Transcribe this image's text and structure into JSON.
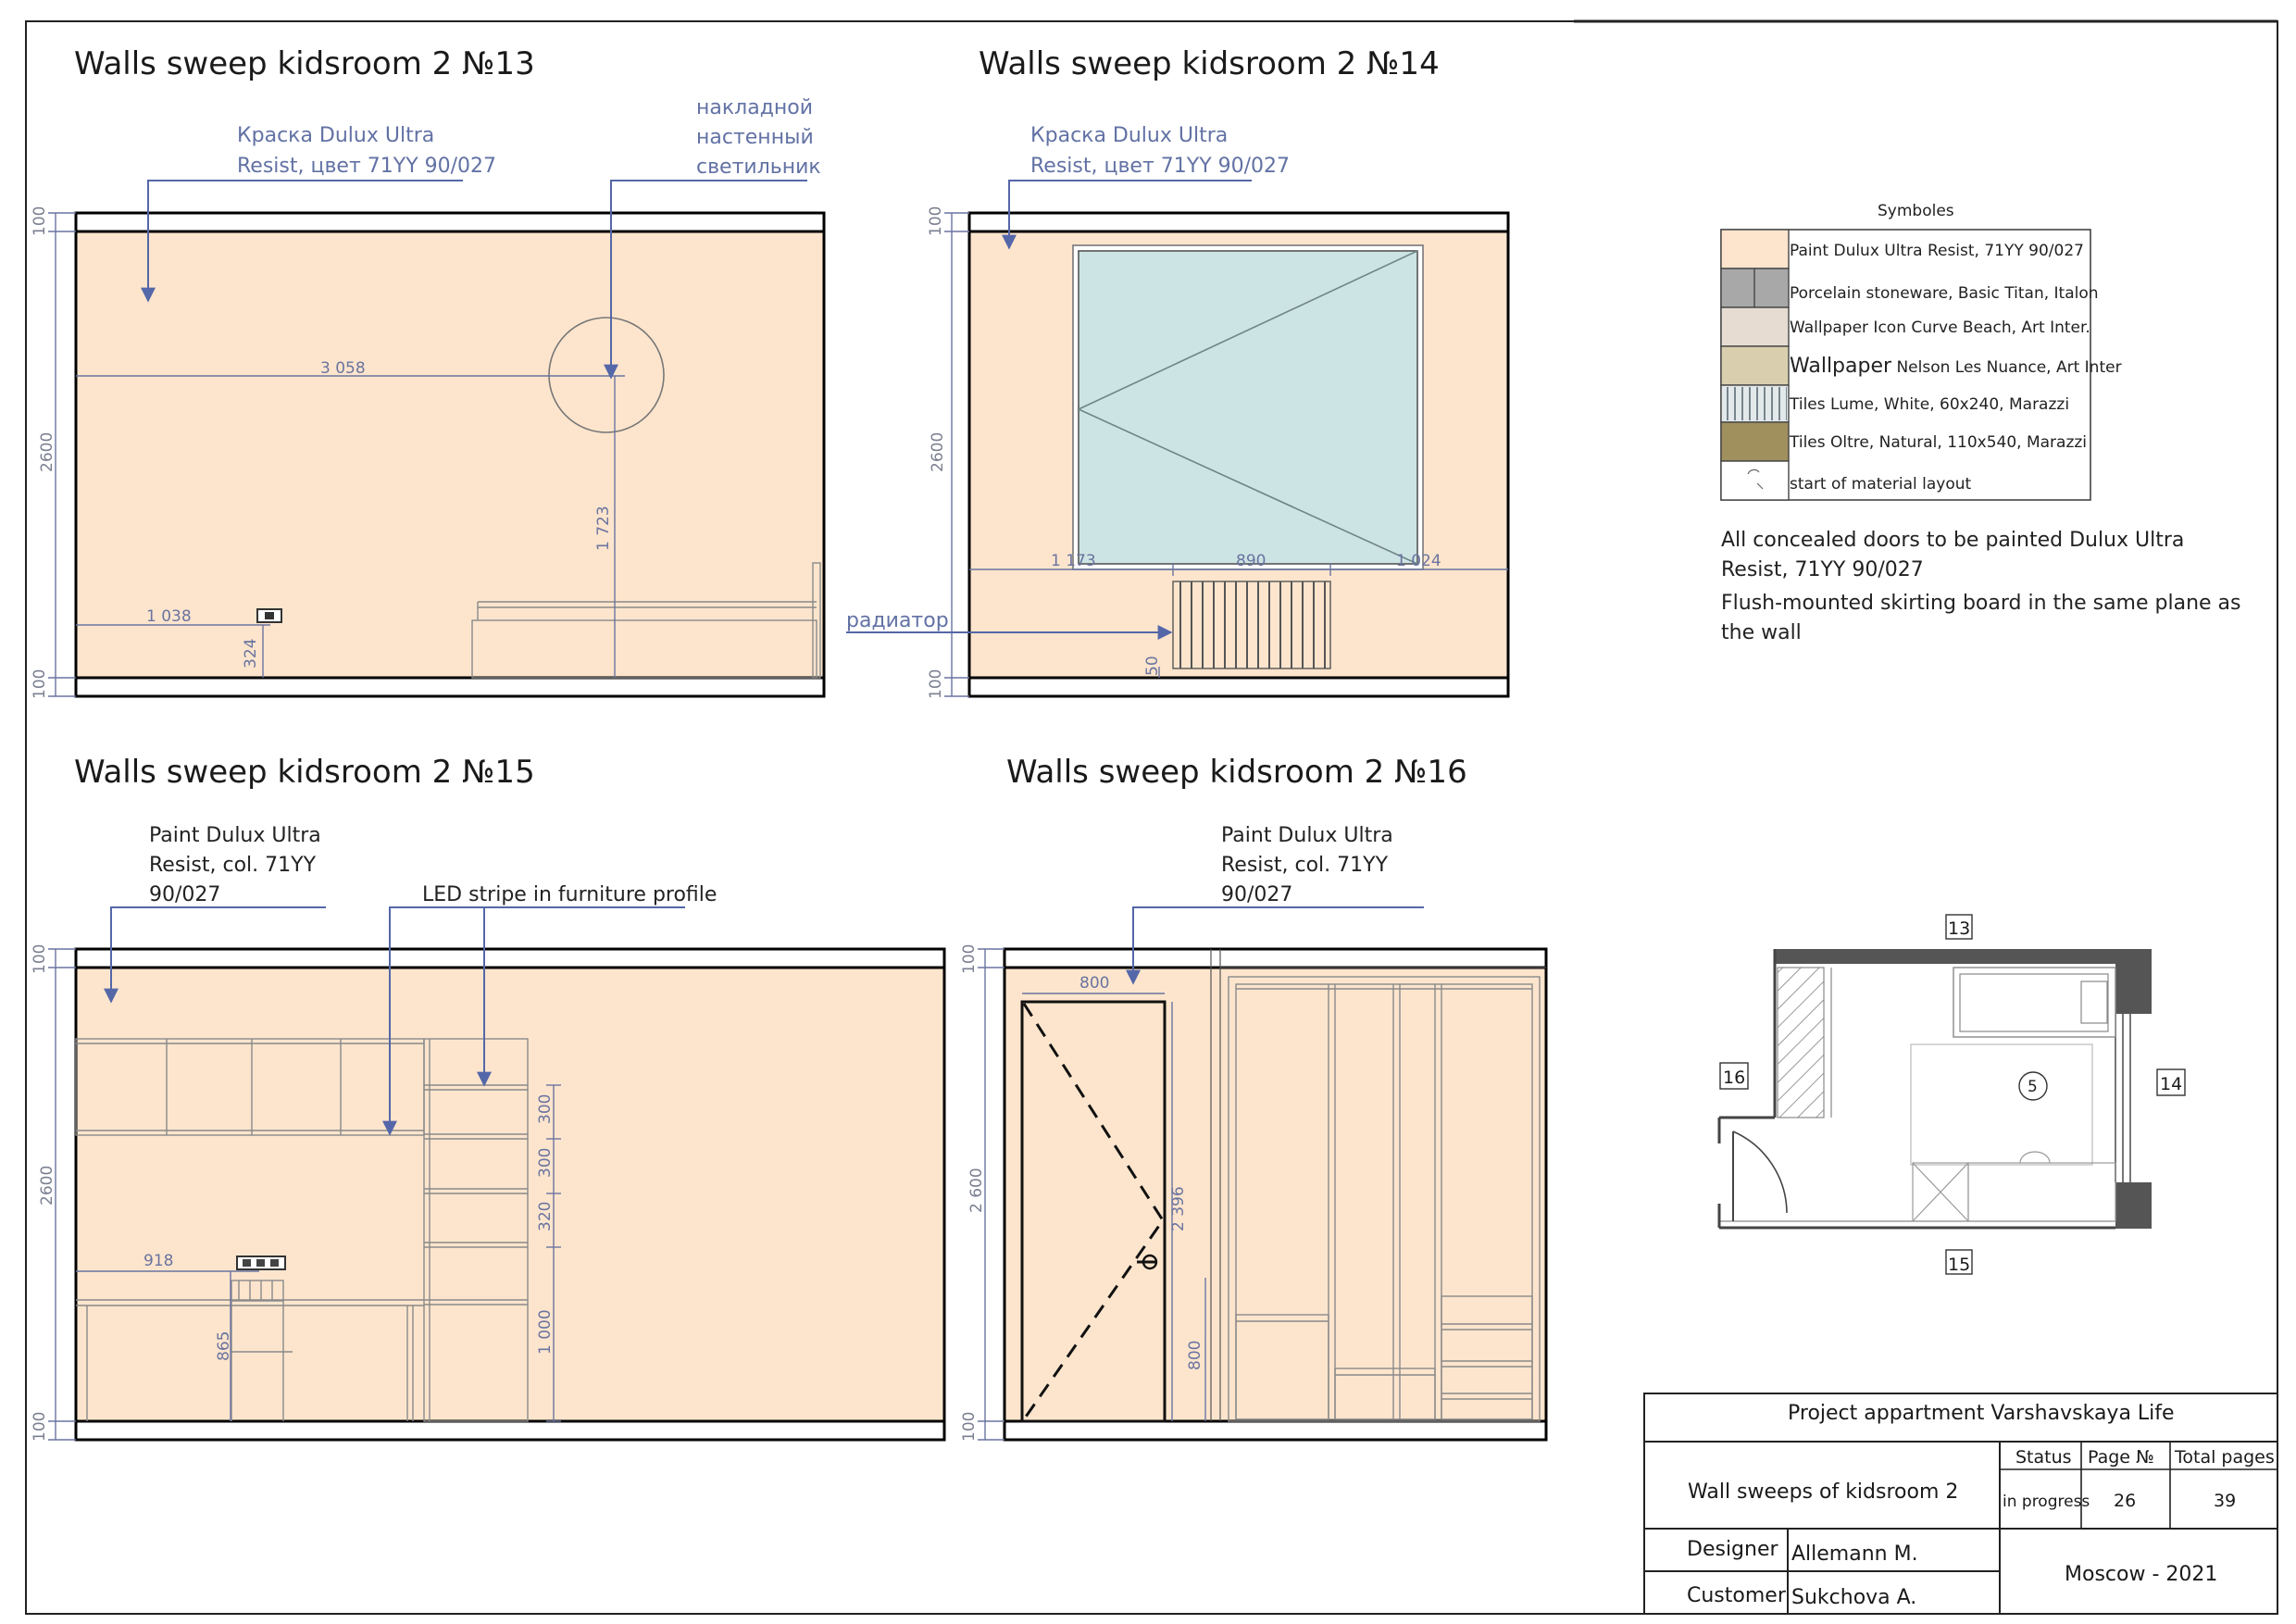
{
  "sheet": {
    "elevation_13": {
      "title": "Walls sweep kidsroom 2 №13",
      "note_paint": [
        "Краска Dulux Ultra",
        "Resist, цвет 71YY 90/027"
      ],
      "note_lamp": [
        "накладной",
        "настенный",
        "светильник"
      ],
      "dims": {
        "top": "100",
        "height": "2600",
        "bottom": "100",
        "width": "3 058",
        "lamp_height": "1 723",
        "socket_offset": "1 038",
        "socket_height": "324"
      }
    },
    "elevation_14": {
      "title": "Walls sweep kidsroom 2 №14",
      "note_paint": [
        "Краска Dulux Ultra",
        "Resist, цвет 71YY 90/027"
      ],
      "radiator_label": "радиатор",
      "dims": {
        "top": "100",
        "height": "2600",
        "bottom": "100",
        "left": "1 173",
        "window": "890",
        "right": "1 024",
        "radiator_gap": "50"
      }
    },
    "elevation_15": {
      "title": "Walls sweep kidsroom 2 №15",
      "note_paint": [
        "Paint Dulux Ultra",
        "Resist, col. 71YY",
        "90/027"
      ],
      "note_led": "LED stripe in furniture profile",
      "dims": {
        "top": "100",
        "height": "2600",
        "bottom": "100",
        "socket_offset": "918",
        "socket_height": "865",
        "shelf_1": "300",
        "shelf_2": "300",
        "shelf_3": "320",
        "base": "1 000"
      }
    },
    "elevation_16": {
      "title": "Walls sweep kidsroom 2 №16",
      "note_paint": [
        "Paint Dulux Ultra",
        "Resist, col. 71YY",
        "90/027"
      ],
      "dims": {
        "top": "100",
        "height": "2 600",
        "bottom": "100",
        "door_width": "800",
        "door_height": "2 396",
        "handle_height": "800"
      }
    },
    "legend": {
      "title": "Symboles",
      "items": [
        {
          "swatch": "paint",
          "color": "#fde5cd",
          "label": "Paint Dulux Ultra Resist, 71YY 90/027"
        },
        {
          "swatch": "porcelain",
          "color": "#a8a8a8",
          "label": "Porcelain stoneware, Basic Titan, Italon"
        },
        {
          "swatch": "wallpaper1",
          "color": "#e6dcd2",
          "label": "Wallpaper Icon Curve Beach, Art  Inter."
        },
        {
          "swatch": "wallpaper2",
          "color": "#d9cfae",
          "label_big": "Wallpaper",
          "label_rest": " Nelson Les Nuance, Art Inter"
        },
        {
          "swatch": "tiles_lume",
          "color": "#e3e9ea",
          "label": "Tiles Lume, White, 60x240, Marazzi"
        },
        {
          "swatch": "tiles_oltre",
          "color": "#a0905e",
          "label": "Tiles Oltre, Natural, 110x540, Marazzi"
        },
        {
          "swatch": "start",
          "color": "#ffffff",
          "label": "start of material layout"
        }
      ]
    },
    "notes": {
      "doors": [
        "All concealed doors to be painted Dulux Ultra",
        "Resist, 71YY 90/027"
      ],
      "skirting": [
        "Flush-mounted skirting board in the same plane as",
        "the wall"
      ]
    },
    "plan": {
      "tag_top": "13",
      "tag_right": "14",
      "tag_bottom": "15",
      "tag_left": "16",
      "marker": "5"
    },
    "title_block": {
      "project": "Project appartment Varshavskaya Life",
      "sheet_name": "Wall sweeps of kidsroom 2",
      "status_label": "Status",
      "status_value": "in progress",
      "page_label": "Page №",
      "page_value": "26",
      "total_label": "Total pages",
      "total_value": "39",
      "designer_label": "Designer",
      "designer_value": "Allemann M.",
      "customer_label": "Customer",
      "customer_value": "Sukchova A.",
      "city_year": "Moscow - 2021"
    }
  }
}
